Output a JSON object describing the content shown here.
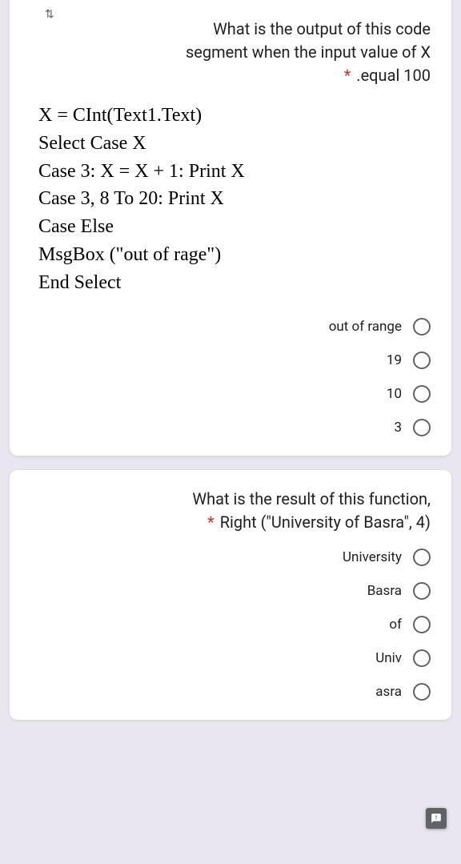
{
  "icons": {
    "top_left": "⇅"
  },
  "q1": {
    "title_line1": "What is the output of this code",
    "title_line2": "segment when the input value of X",
    "title_line3": ".equal 100",
    "required_mark": "*",
    "code": [
      "X = CInt(Text1.Text)",
      "Select Case X",
      "Case 3: X = X + 1: Print X",
      "Case 3, 8 To 20: Print X",
      "Case Else",
      "MsgBox (\"out of rage\")",
      "End Select"
    ],
    "options": [
      "out of range",
      "19",
      "10",
      "3"
    ]
  },
  "q2": {
    "title_line1": "What is the result of this function,",
    "title_line2": "Right (\"University of Basra\", 4)",
    "required_mark": "*",
    "options": [
      "University",
      "Basra",
      "of",
      "Univ",
      "asra"
    ]
  }
}
